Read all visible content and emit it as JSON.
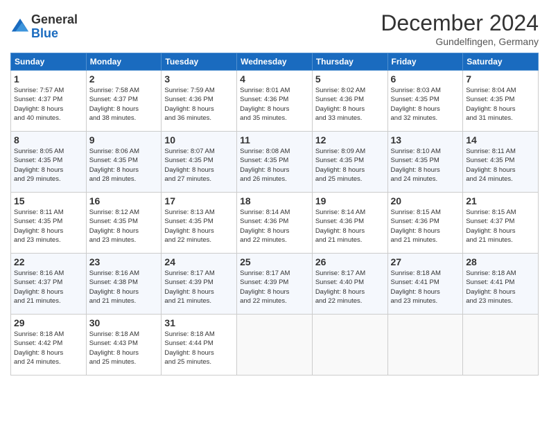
{
  "header": {
    "logo_line1": "General",
    "logo_line2": "Blue",
    "month_title": "December 2024",
    "location": "Gundelfingen, Germany"
  },
  "days_of_week": [
    "Sunday",
    "Monday",
    "Tuesday",
    "Wednesday",
    "Thursday",
    "Friday",
    "Saturday"
  ],
  "weeks": [
    [
      {
        "day": "1",
        "info": "Sunrise: 7:57 AM\nSunset: 4:37 PM\nDaylight: 8 hours\nand 40 minutes."
      },
      {
        "day": "2",
        "info": "Sunrise: 7:58 AM\nSunset: 4:37 PM\nDaylight: 8 hours\nand 38 minutes."
      },
      {
        "day": "3",
        "info": "Sunrise: 7:59 AM\nSunset: 4:36 PM\nDaylight: 8 hours\nand 36 minutes."
      },
      {
        "day": "4",
        "info": "Sunrise: 8:01 AM\nSunset: 4:36 PM\nDaylight: 8 hours\nand 35 minutes."
      },
      {
        "day": "5",
        "info": "Sunrise: 8:02 AM\nSunset: 4:36 PM\nDaylight: 8 hours\nand 33 minutes."
      },
      {
        "day": "6",
        "info": "Sunrise: 8:03 AM\nSunset: 4:35 PM\nDaylight: 8 hours\nand 32 minutes."
      },
      {
        "day": "7",
        "info": "Sunrise: 8:04 AM\nSunset: 4:35 PM\nDaylight: 8 hours\nand 31 minutes."
      }
    ],
    [
      {
        "day": "8",
        "info": "Sunrise: 8:05 AM\nSunset: 4:35 PM\nDaylight: 8 hours\nand 29 minutes."
      },
      {
        "day": "9",
        "info": "Sunrise: 8:06 AM\nSunset: 4:35 PM\nDaylight: 8 hours\nand 28 minutes."
      },
      {
        "day": "10",
        "info": "Sunrise: 8:07 AM\nSunset: 4:35 PM\nDaylight: 8 hours\nand 27 minutes."
      },
      {
        "day": "11",
        "info": "Sunrise: 8:08 AM\nSunset: 4:35 PM\nDaylight: 8 hours\nand 26 minutes."
      },
      {
        "day": "12",
        "info": "Sunrise: 8:09 AM\nSunset: 4:35 PM\nDaylight: 8 hours\nand 25 minutes."
      },
      {
        "day": "13",
        "info": "Sunrise: 8:10 AM\nSunset: 4:35 PM\nDaylight: 8 hours\nand 24 minutes."
      },
      {
        "day": "14",
        "info": "Sunrise: 8:11 AM\nSunset: 4:35 PM\nDaylight: 8 hours\nand 24 minutes."
      }
    ],
    [
      {
        "day": "15",
        "info": "Sunrise: 8:11 AM\nSunset: 4:35 PM\nDaylight: 8 hours\nand 23 minutes."
      },
      {
        "day": "16",
        "info": "Sunrise: 8:12 AM\nSunset: 4:35 PM\nDaylight: 8 hours\nand 23 minutes."
      },
      {
        "day": "17",
        "info": "Sunrise: 8:13 AM\nSunset: 4:35 PM\nDaylight: 8 hours\nand 22 minutes."
      },
      {
        "day": "18",
        "info": "Sunrise: 8:14 AM\nSunset: 4:36 PM\nDaylight: 8 hours\nand 22 minutes."
      },
      {
        "day": "19",
        "info": "Sunrise: 8:14 AM\nSunset: 4:36 PM\nDaylight: 8 hours\nand 21 minutes."
      },
      {
        "day": "20",
        "info": "Sunrise: 8:15 AM\nSunset: 4:36 PM\nDaylight: 8 hours\nand 21 minutes."
      },
      {
        "day": "21",
        "info": "Sunrise: 8:15 AM\nSunset: 4:37 PM\nDaylight: 8 hours\nand 21 minutes."
      }
    ],
    [
      {
        "day": "22",
        "info": "Sunrise: 8:16 AM\nSunset: 4:37 PM\nDaylight: 8 hours\nand 21 minutes."
      },
      {
        "day": "23",
        "info": "Sunrise: 8:16 AM\nSunset: 4:38 PM\nDaylight: 8 hours\nand 21 minutes."
      },
      {
        "day": "24",
        "info": "Sunrise: 8:17 AM\nSunset: 4:39 PM\nDaylight: 8 hours\nand 21 minutes."
      },
      {
        "day": "25",
        "info": "Sunrise: 8:17 AM\nSunset: 4:39 PM\nDaylight: 8 hours\nand 22 minutes."
      },
      {
        "day": "26",
        "info": "Sunrise: 8:17 AM\nSunset: 4:40 PM\nDaylight: 8 hours\nand 22 minutes."
      },
      {
        "day": "27",
        "info": "Sunrise: 8:18 AM\nSunset: 4:41 PM\nDaylight: 8 hours\nand 23 minutes."
      },
      {
        "day": "28",
        "info": "Sunrise: 8:18 AM\nSunset: 4:41 PM\nDaylight: 8 hours\nand 23 minutes."
      }
    ],
    [
      {
        "day": "29",
        "info": "Sunrise: 8:18 AM\nSunset: 4:42 PM\nDaylight: 8 hours\nand 24 minutes."
      },
      {
        "day": "30",
        "info": "Sunrise: 8:18 AM\nSunset: 4:43 PM\nDaylight: 8 hours\nand 25 minutes."
      },
      {
        "day": "31",
        "info": "Sunrise: 8:18 AM\nSunset: 4:44 PM\nDaylight: 8 hours\nand 25 minutes."
      },
      {
        "day": "",
        "info": ""
      },
      {
        "day": "",
        "info": ""
      },
      {
        "day": "",
        "info": ""
      },
      {
        "day": "",
        "info": ""
      }
    ]
  ]
}
